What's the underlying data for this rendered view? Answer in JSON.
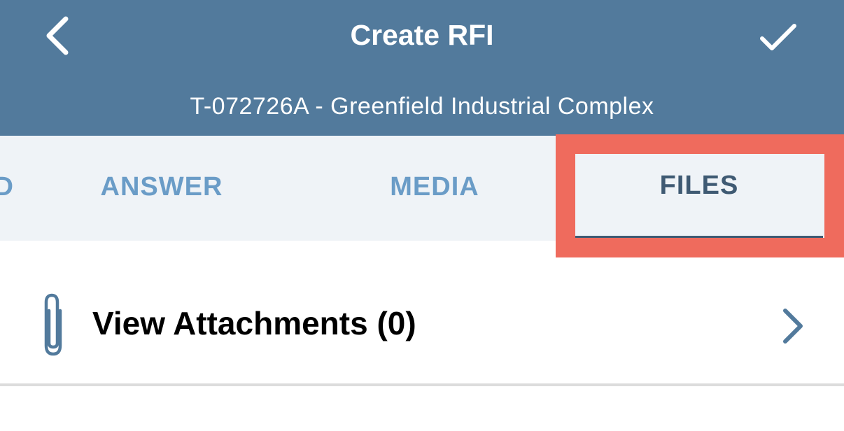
{
  "header": {
    "title": "Create RFI",
    "subtitle": "T-072726A - Greenfield Industrial Complex",
    "background_color": "#527a9c",
    "back_icon": "chevron-left-icon",
    "confirm_icon": "checkmark-icon"
  },
  "tabs": {
    "partial_label": "D",
    "items": [
      {
        "label": "ANSWER",
        "selected": false
      },
      {
        "label": "MEDIA",
        "selected": false
      },
      {
        "label": "FILES",
        "selected": true
      }
    ],
    "inactive_color": "#6a9cc7",
    "active_color": "#3f5a73",
    "highlight_color": "#ef6b5d"
  },
  "attachments": {
    "label": "View Attachments (0)",
    "icon": "paperclip-icon",
    "chevron_icon": "chevron-right-icon"
  }
}
